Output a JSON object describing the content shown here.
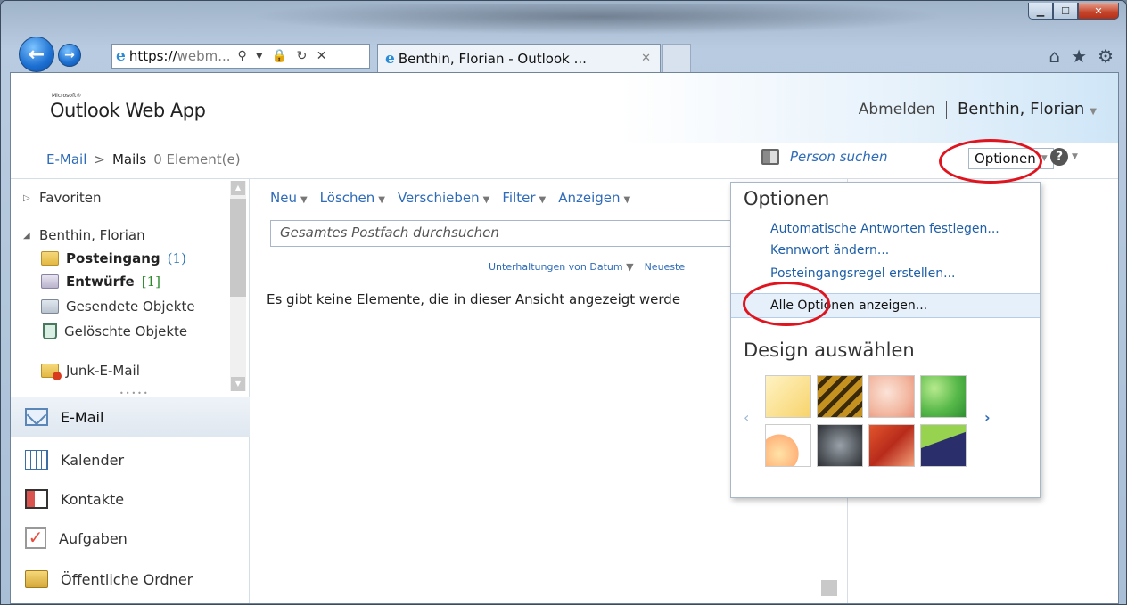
{
  "browser": {
    "url_scheme": "https://",
    "url_rest": "webm...",
    "address_controls": "⚲ ▾ 🔒 ↻ ✕",
    "tab_title": "Benthin, Florian - Outlook ...",
    "tab_close": "✕",
    "window_controls": {
      "minimize": "▁",
      "maximize": "☐",
      "close": "✕"
    },
    "tools": [
      "⌂",
      "★",
      "⚙"
    ]
  },
  "header": {
    "logo_small": "Microsoft®",
    "logo": "Outlook Web App",
    "signout": "Abmelden",
    "user": "Benthin, Florian"
  },
  "breadcrumb": {
    "root": "E-Mail",
    "separator": ">",
    "current": "Mails",
    "count": "0 Element(e)"
  },
  "topbar": {
    "find_person": "Person suchen",
    "options": "Optionen",
    "help": "?"
  },
  "folders": {
    "favorites": "Favoriten",
    "account": "Benthin, Florian",
    "items": [
      {
        "label": "Posteingang",
        "count": "(1)"
      },
      {
        "label": "Entwürfe",
        "count": "[1]"
      },
      {
        "label": "Gesendete Objekte",
        "count": ""
      },
      {
        "label": "Gelöschte Objekte",
        "count": ""
      },
      {
        "label": "Junk-E-Mail",
        "count": ""
      }
    ]
  },
  "nav": {
    "mail": "E-Mail",
    "calendar": "Kalender",
    "contacts": "Kontakte",
    "tasks": "Aufgaben",
    "public": "Öffentliche Ordner"
  },
  "toolbar": {
    "new": "Neu",
    "delete": "Löschen",
    "move": "Verschieben",
    "filter": "Filter",
    "view": "Anzeigen"
  },
  "search": {
    "placeholder": "Gesamtes Postfach durchsuchen"
  },
  "sort": {
    "by": "Unterhaltungen von Datum",
    "order": "Neueste"
  },
  "empty_message": "Es gibt keine Elemente, die in dieser Ansicht angezeigt werde",
  "options_menu": {
    "title": "Optionen",
    "auto_reply": "Automatische Antworten festlegen...",
    "change_password": "Kennwort ändern...",
    "inbox_rule": "Posteingangsregel erstellen...",
    "all_options": "Alle Optionen anzeigen...",
    "design_title": "Design auswählen",
    "prev": "‹",
    "next": "›"
  },
  "colors": {
    "link": "#2e6bb8",
    "annotation": "#e0141e",
    "highlight": "#e6f0fa"
  }
}
